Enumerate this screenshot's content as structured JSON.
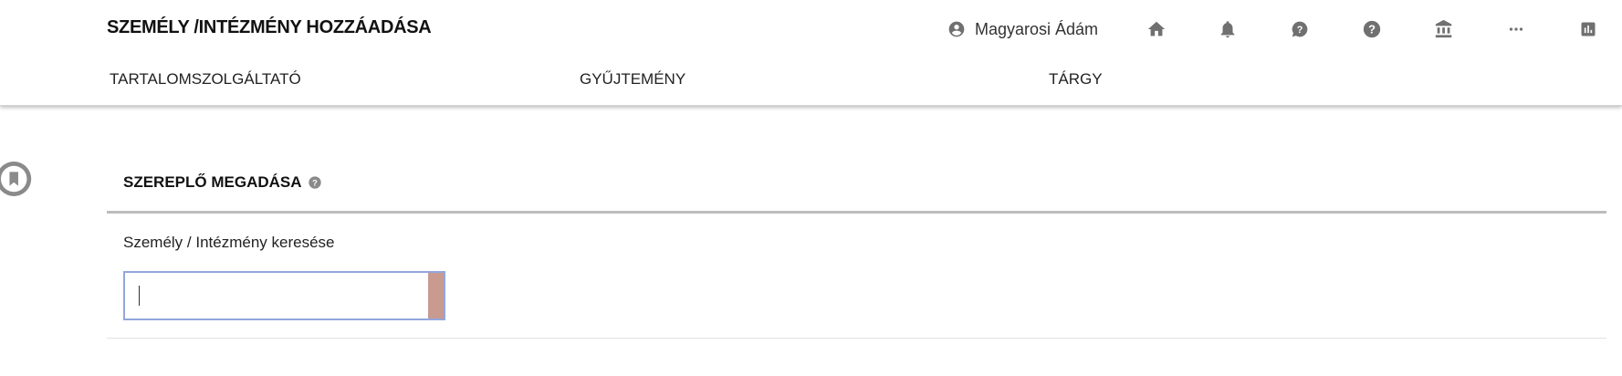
{
  "header": {
    "title": "SZEMÉLY /INTÉZMÉNY HOZZÁADÁSA",
    "user_name": "Magyarosi Ádám",
    "icons": [
      "account-circle-icon",
      "home-icon",
      "bell-icon",
      "help-bubble-icon",
      "help-circle-icon",
      "institution-icon",
      "more-icon",
      "chart-icon"
    ]
  },
  "nav": {
    "tabs": [
      {
        "label": "TARTALOMSZOLGÁLTATÓ"
      },
      {
        "label": "GYŰJTEMÉNY"
      },
      {
        "label": "TÁRGY"
      }
    ]
  },
  "section": {
    "title": "SZEREPLŐ MEGADÁSA",
    "search_label": "Személy / Intézmény keresése",
    "search_value": ""
  },
  "colors": {
    "icon_gray": "#707070",
    "input_border": "#93a6dc",
    "search_button": "#c89a90",
    "section_rule": "#bdbdbd"
  }
}
